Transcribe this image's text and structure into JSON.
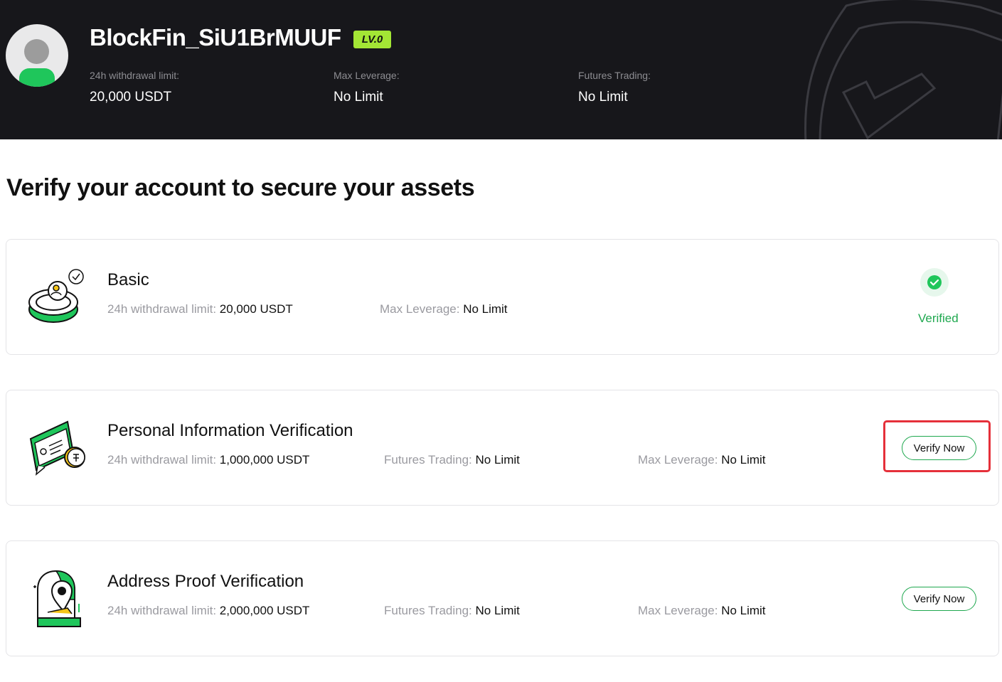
{
  "profile": {
    "username": "BlockFin_SiU1BrMUUF",
    "level": "LV.0",
    "stats": [
      {
        "label": "24h withdrawal limit:",
        "value": "20,000 USDT"
      },
      {
        "label": "Max Leverage:",
        "value": "No Limit"
      },
      {
        "label": "Futures Trading:",
        "value": "No Limit"
      }
    ]
  },
  "page_title": "Verify your account to secure your assets",
  "cards": [
    {
      "title": "Basic",
      "illustration": "coin-user-icon",
      "stats": [
        {
          "label": "24h withdrawal limit:",
          "value": "20,000 USDT"
        },
        {
          "label": "Max Leverage:",
          "value": "No Limit"
        }
      ],
      "status": "Verified"
    },
    {
      "title": "Personal Information Verification",
      "illustration": "id-card-icon",
      "stats": [
        {
          "label": "24h withdrawal limit:",
          "value": "1,000,000 USDT"
        },
        {
          "label": "Futures Trading:",
          "value": "No Limit"
        },
        {
          "label": "Max Leverage:",
          "value": "No Limit"
        }
      ],
      "action": "Verify Now",
      "highlighted": true
    },
    {
      "title": "Address Proof Verification",
      "illustration": "location-pin-icon",
      "stats": [
        {
          "label": "24h withdrawal limit:",
          "value": "2,000,000 USDT"
        },
        {
          "label": "Futures Trading:",
          "value": "No Limit"
        },
        {
          "label": "Max Leverage:",
          "value": "No Limit"
        }
      ],
      "action": "Verify Now"
    }
  ],
  "colors": {
    "header_bg": "#17171b",
    "brand_green": "#1fc65b",
    "level_badge": "#a3e635",
    "verified_green": "#1fa84f",
    "highlight_red": "#e5303a"
  }
}
